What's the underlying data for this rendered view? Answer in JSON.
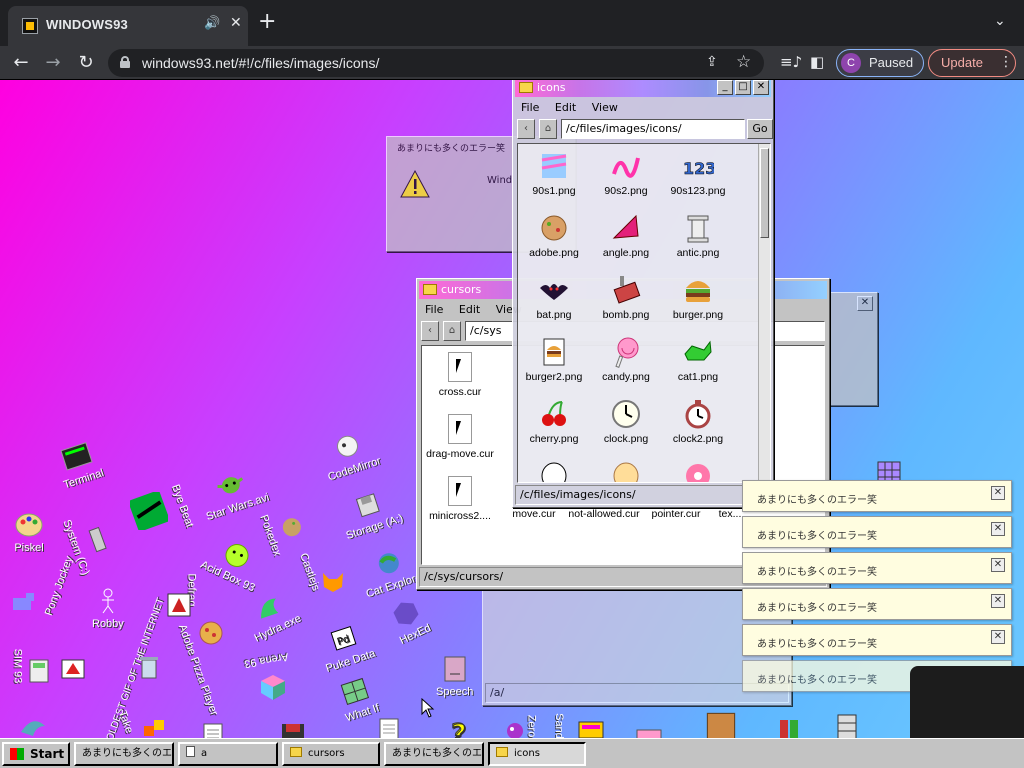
{
  "browser": {
    "tab_title": "WINDOWS93",
    "url": "windows93.net/#!/c/files/images/icons/",
    "profile_initial": "C",
    "profile_status": "Paused",
    "update_label": "Update"
  },
  "desktop_icons": [
    {
      "label": "Terminal"
    },
    {
      "label": "CodeMirror"
    },
    {
      "label": "Piskel"
    },
    {
      "label": "System (C:)"
    },
    {
      "label": "Bye Beat"
    },
    {
      "label": "Star Wars.avi"
    },
    {
      "label": "Pokedex"
    },
    {
      "label": "Storage (A:)"
    },
    {
      "label": "Acid Box 93"
    },
    {
      "label": "Cat Explorer"
    },
    {
      "label": "Pony Jockey"
    },
    {
      "label": "Robby"
    },
    {
      "label": "Defrag"
    },
    {
      "label": "Hydra.exe"
    },
    {
      "label": "Castlejs"
    },
    {
      "label": "HexEd"
    },
    {
      "label": "Arena 93"
    },
    {
      "label": "Puke Data"
    },
    {
      "label": "SIM 93"
    },
    {
      "label": "Speech"
    },
    {
      "label": "What If"
    },
    {
      "label": "Adobe Pizza Player"
    },
    {
      "label": "OLDEST GIF OF THE INTERNET"
    },
    {
      "label": "Take"
    },
    {
      "label": "Zero"
    },
    {
      "label": "Sand"
    }
  ],
  "error_dialog": {
    "title": "あまりにも多くのエラー笑",
    "text": "Wind"
  },
  "cursors_window": {
    "title": "cursors",
    "menu": [
      "File",
      "Edit",
      "View"
    ],
    "path": "/c/sys",
    "status": "/c/sys/cursors/",
    "files": [
      "cross.cur",
      "drag-move.cur",
      "minicross2....",
      "move.cur",
      "not-allowed.cur",
      "pointer.cur",
      "tex..."
    ]
  },
  "icons_window": {
    "title": "icons",
    "menu": [
      "File",
      "Edit",
      "View"
    ],
    "path": "/c/files/images/icons/",
    "go_label": "Go",
    "status": "/c/files/images/icons/",
    "files": [
      "90s1.png",
      "90s2.png",
      "90s123.png",
      "adobe.png",
      "angle.png",
      "antic.png",
      "bat.png",
      "bomb.png",
      "burger.png",
      "burger2.png",
      "candy.png",
      "cat1.png",
      "cherry.png",
      "clock.png",
      "clock2.png"
    ]
  },
  "back_window": {
    "status": "/a/"
  },
  "toasts": [
    {
      "text": "あまりにも多くのエラー笑"
    },
    {
      "text": "あまりにも多くのエラー笑"
    },
    {
      "text": "あまりにも多くのエラー笑"
    },
    {
      "text": "あまりにも多くのエラー笑"
    },
    {
      "text": "あまりにも多くのエラー笑"
    },
    {
      "text": "あまりにも多くのエラー笑"
    }
  ],
  "taskbar": {
    "start_label": "Start",
    "tasks": [
      {
        "label": "あまりにも多くのエ..."
      },
      {
        "label": "a"
      },
      {
        "label": "cursors"
      },
      {
        "label": "あまりにも多くのエ..."
      },
      {
        "label": "icons"
      }
    ]
  },
  "colors": {
    "desktop_gradient_start": "#ff00e0",
    "desktop_gradient_end": "#6cc9ff",
    "title_gradient_start": "#ff6ad5",
    "title_gradient_end": "#94d0ff",
    "chrome_dark": "#202124"
  }
}
